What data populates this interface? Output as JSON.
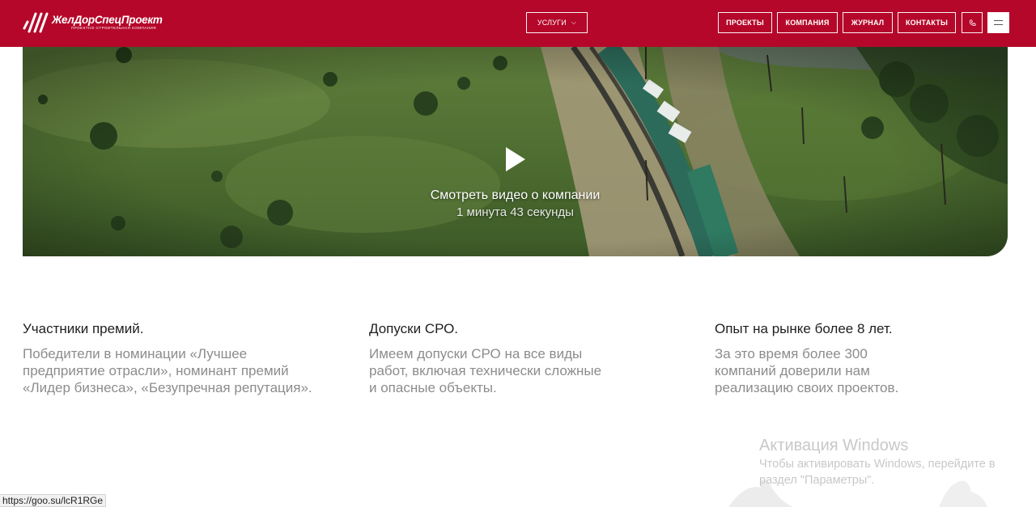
{
  "header": {
    "logo_name": "ЖелДорСпецПроект",
    "logo_tagline": "ПРОЕКТНО-СТРОИТЕЛЬНАЯ КОМПАНИЯ",
    "services_label": "УСЛУГИ",
    "nav": [
      "ПРОЕКТЫ",
      "КОМПАНИЯ",
      "ЖУРНАЛ",
      "КОНТАКТЫ"
    ],
    "brand_color": "#b5072a",
    "phone_icon": "phone-icon",
    "menu_icon": "hamburger-icon"
  },
  "video": {
    "title": "Смотреть видео о компании",
    "duration": "1 минута 43 секунды"
  },
  "features": [
    {
      "title": "Участники премий.",
      "text": "Победители в номинации «Лучшее предприятие отрасли», номинант премий «Лидер бизнеса», «Безупречная репутация»."
    },
    {
      "title": "Допуски СРО.",
      "text": "Имеем допуски СРО на все виды работ, включая технически сложные и опасные объекты."
    },
    {
      "title": "Опыт на рынке более 8 лет.",
      "text": "За это время более 300 компаний доверили нам реализацию своих проектов."
    }
  ],
  "windows_activation": {
    "title": "Активация Windows",
    "line1": "Чтобы активировать Windows, перейдите в",
    "line2": "раздел \"Параметры\"."
  },
  "status_url": "https://goo.su/lcR1RGe"
}
